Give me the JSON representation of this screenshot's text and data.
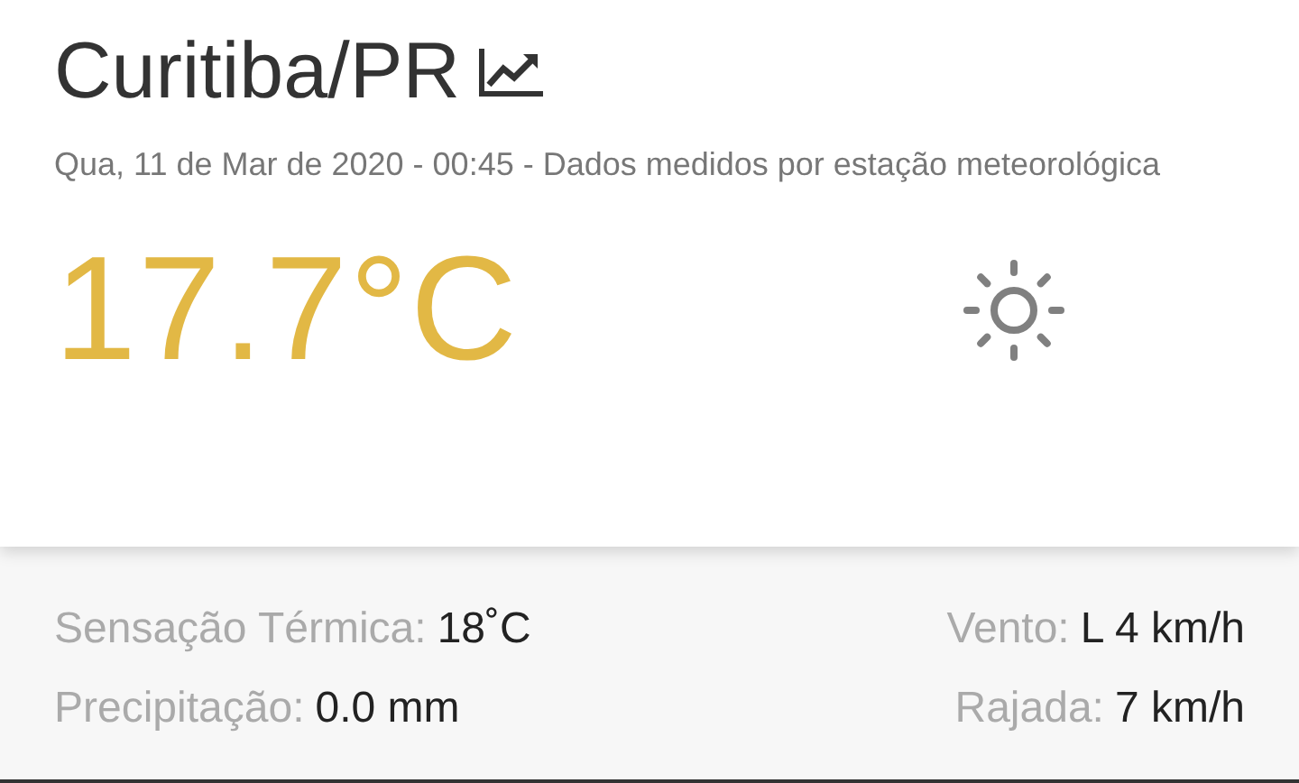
{
  "header": {
    "city": "Curitiba/PR",
    "subtitle": "Qua, 11 de Mar de 2020 - 00:45 - Dados medidos por estação meteorológica"
  },
  "current": {
    "temperature": "17.7°C"
  },
  "stats_left": [
    {
      "label": "Sensação Térmica:",
      "value": "18˚C"
    },
    {
      "label": "Precipitação:",
      "value": "0.0 mm"
    }
  ],
  "stats_right": [
    {
      "label": "Vento:",
      "value": "L 4 km/h"
    },
    {
      "label": "Rajada:",
      "value": "7 km/h"
    }
  ]
}
